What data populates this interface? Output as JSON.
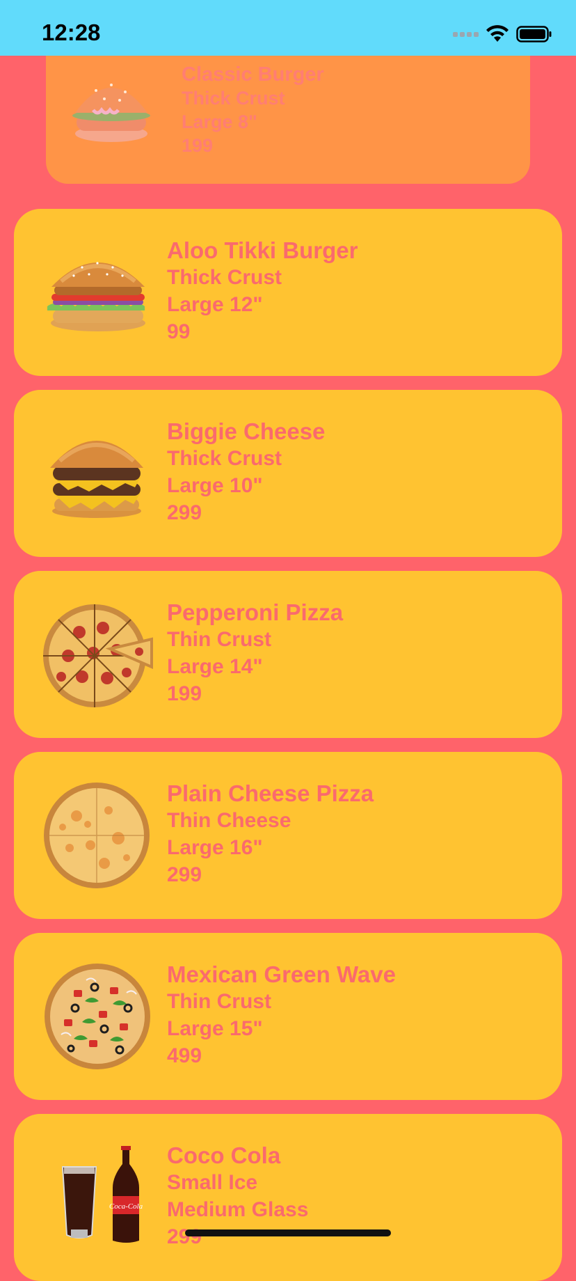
{
  "status_bar": {
    "time": "12:28"
  },
  "menu": {
    "items": [
      {
        "name": "Classic Burger",
        "crust": "Thick Crust",
        "size": "Large 8\"",
        "price": "199",
        "image": "burger-image"
      },
      {
        "name": "Aloo Tikki Burger",
        "crust": "Thick Crust",
        "size": "Large 12\"",
        "price": "99",
        "image": "burger-image"
      },
      {
        "name": "Biggie Cheese",
        "crust": "Thick Crust",
        "size": "Large 10\"",
        "price": "299",
        "image": "double-cheeseburger-image"
      },
      {
        "name": "Pepperoni Pizza",
        "crust": "Thin Crust",
        "size": "Large 14\"",
        "price": "199",
        "image": "pepperoni-pizza-image"
      },
      {
        "name": "Plain Cheese Pizza",
        "crust": "Thin Cheese",
        "size": "Large 16\"",
        "price": "299",
        "image": "cheese-pizza-image"
      },
      {
        "name": "Mexican Green Wave",
        "crust": "Thin Crust",
        "size": "Large 15\"",
        "price": "499",
        "image": "veggie-pizza-image"
      },
      {
        "name": "Coco Cola",
        "crust": "Small Ice",
        "size": "Medium Glass",
        "price": "299",
        "image": "cola-bottle-glass-image"
      }
    ]
  },
  "colors": {
    "background": "#FF636A",
    "status_bar": "#61DBFB",
    "card": "#FFC331",
    "card_faded": "#FF9447",
    "text": "#FA6A6D"
  }
}
